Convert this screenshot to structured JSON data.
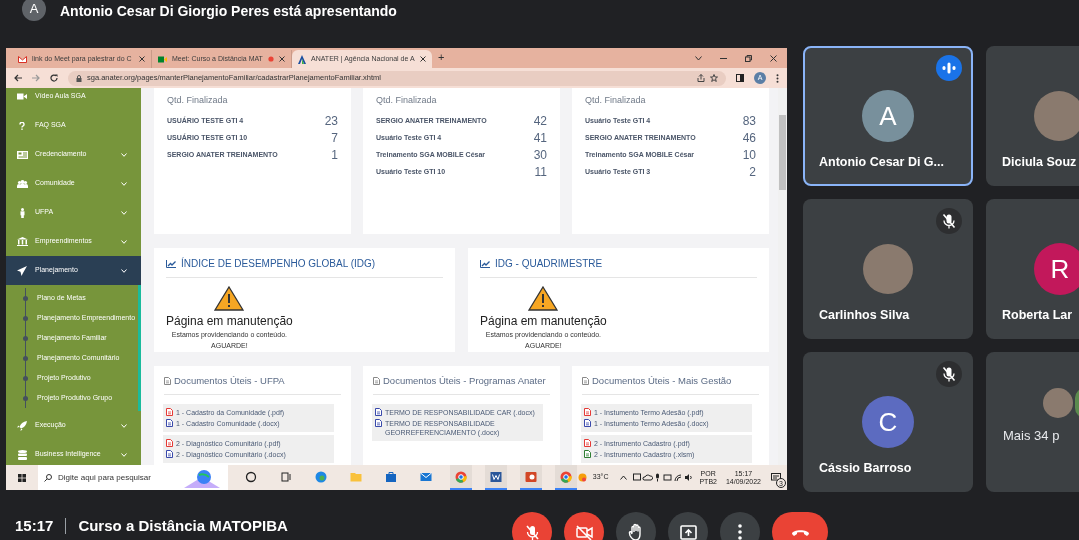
{
  "presenter_banner": {
    "avatar": "A",
    "text": "Antonio Cesar Di Giorgio Peres está apresentando"
  },
  "shared_screen": {
    "browser_tabs": [
      {
        "kind": "gmail",
        "title": "link do Meet para palestrar do C",
        "selected": false,
        "recording": false
      },
      {
        "kind": "meet",
        "title": "Meet: Curso a Distância MAT",
        "selected": false,
        "recording": true
      },
      {
        "kind": "anater",
        "title": "ANATER | Agência Nacional de A",
        "selected": true,
        "recording": false
      }
    ],
    "new_tab": "+",
    "address": "sga.anater.org/pages/manterPlanejamentoFamiliar/cadastrarPlanejamentoFamiliar.xhtml",
    "profile_avatar": "A",
    "sidebar": [
      {
        "kind": "video",
        "label": "Vídeo Aula SGA",
        "expandable": false,
        "selected": false
      },
      {
        "kind": "help",
        "label": "FAQ SGA",
        "expandable": false,
        "selected": false
      },
      {
        "kind": "card",
        "label": "Credenciamento",
        "expandable": true,
        "selected": false
      },
      {
        "kind": "people",
        "label": "Comunidade",
        "expandable": true,
        "selected": false
      },
      {
        "kind": "person",
        "label": "UFPA",
        "expandable": true,
        "selected": false
      },
      {
        "kind": "building",
        "label": "Empreendimentos",
        "expandable": true,
        "selected": false
      },
      {
        "kind": "plane",
        "label": "Planejamento",
        "expandable": true,
        "selected": true,
        "children": [
          {
            "label": "Plano de Metas",
            "selected": false
          },
          {
            "label": "Planejamento Empreendimento",
            "selected": false
          },
          {
            "label": "Planejamento Familiar",
            "selected": false
          },
          {
            "label": "Planejamento Comunitário",
            "selected": false
          },
          {
            "label": "Projeto Produtivo",
            "selected": false
          },
          {
            "label": "Projeto Produtivo Grupo",
            "selected": false
          }
        ]
      },
      {
        "kind": "rocket",
        "label": "Execução",
        "expandable": true,
        "selected": false
      },
      {
        "kind": "database",
        "label": "Business Intelligence",
        "expandable": true,
        "selected": false
      }
    ],
    "count_cards": [
      {
        "title": "Qtd. Finalizada",
        "rows": [
          {
            "name": "USUÁRIO TESTE GTI 4",
            "value": "23"
          },
          {
            "name": "USUÁRIO TESTE GTI 10",
            "value": "7"
          },
          {
            "name": "SERGIO ANATER TREINAMENTO",
            "value": "1"
          }
        ]
      },
      {
        "title": "Qtd. Finalizada",
        "rows": [
          {
            "name": "SERGIO ANATER TREINAMENTO",
            "value": "42"
          },
          {
            "name": "Usuário Teste GTI 4",
            "value": "41"
          },
          {
            "name": "Treinamento SGA MOBILE César",
            "value": "30"
          },
          {
            "name": "Usuário Teste GTI 10",
            "value": "11"
          }
        ]
      },
      {
        "title": "Qtd. Finalizada",
        "rows": [
          {
            "name": "Usuário Teste GTI 4",
            "value": "83"
          },
          {
            "name": "SERGIO ANATER TREINAMENTO",
            "value": "46"
          },
          {
            "name": "Treinamento SGA MOBILE César",
            "value": "10"
          },
          {
            "name": "Usuário Teste GTI 3",
            "value": "2"
          }
        ]
      }
    ],
    "idg_cards": [
      {
        "title": "ÍNDICE DE DESEMPENHO GLOBAL (IDG)",
        "message": "Página em manutenção",
        "detail": "Estamos providenciando o conteúdo.",
        "wait": "AGUARDE!"
      },
      {
        "title": "IDG - QUADRIMESTRE",
        "message": "Página em manutenção",
        "detail": "Estamos providenciando o conteúdo.",
        "wait": "AGUARDE!"
      }
    ],
    "document_cards": [
      {
        "title": "Documentos Úteis - UFPA",
        "groups": [
          [
            {
              "kind": "pdf",
              "label": "1 - Cadastro da Comunidade (.pdf)"
            },
            {
              "kind": "docx",
              "label": "1 - Cadastro Comunidade (.docx)"
            }
          ],
          [
            {
              "kind": "pdf",
              "label": "2 - Diagnóstico Comunitário (.pdf)"
            },
            {
              "kind": "docx",
              "label": "2 - Diagnóstico Comunitário (.docx)"
            }
          ]
        ]
      },
      {
        "title": "Documentos Úteis - Programas Anater",
        "groups": [
          [
            {
              "kind": "docx",
              "label": "TERMO DE RESPONSABILIDADE CAR (.docx)"
            },
            {
              "kind": "docx",
              "label": "TERMO DE RESPONSABILIDADE GEORREFERENCIAMENTO (.docx)"
            }
          ]
        ]
      },
      {
        "title": "Documentos Úteis - Mais Gestão",
        "groups": [
          [
            {
              "kind": "pdf",
              "label": "1 - Instumento Termo Adesão (.pdf)"
            },
            {
              "kind": "docx",
              "label": "1 - Instumento Termo Adesão (.docx)"
            }
          ],
          [
            {
              "kind": "pdf",
              "label": "2 - Instrumento Cadastro (.pdf)"
            },
            {
              "kind": "xlsm",
              "label": "2 - Instrumento Cadastro (.xlsm)"
            }
          ]
        ]
      }
    ],
    "taskbar": {
      "search_placeholder": "Digite aqui para pesquisar",
      "apps": [
        {
          "kind": "cortana",
          "active": false
        },
        {
          "kind": "taskview",
          "active": false
        },
        {
          "kind": "edge",
          "active": false
        },
        {
          "kind": "folder",
          "active": false
        },
        {
          "kind": "store",
          "active": false
        },
        {
          "kind": "mail",
          "active": false
        },
        {
          "kind": "chrome",
          "active": true
        },
        {
          "kind": "word",
          "active": true
        },
        {
          "kind": "powerpoint",
          "active": true
        },
        {
          "kind": "chrome",
          "active": true
        }
      ],
      "temperature": "33°C",
      "language": "POR",
      "layout": "PTB2",
      "time": "15:17",
      "date": "14/09/2022",
      "notifications": "3"
    }
  },
  "participants": [
    {
      "kind": "letter",
      "name": "Antonio Cesar Di G...",
      "initial": "A",
      "color": "#78909c",
      "speaking": true,
      "muted": false
    },
    {
      "kind": "photo",
      "name": "Diciula Souz",
      "speaking": false,
      "muted": false
    },
    {
      "kind": "photo",
      "name": "Carlinhos Silva",
      "speaking": false,
      "muted": true
    },
    {
      "kind": "letter",
      "name": "Roberta Lar",
      "initial": "R",
      "color": "#c2185b",
      "speaking": false,
      "muted": false
    },
    {
      "kind": "letter",
      "name": "Cássio Barroso",
      "initial": "C",
      "color": "#5c6bc0",
      "speaking": false,
      "muted": true
    },
    {
      "kind": "more",
      "name": "Mais 34 p",
      "speaking": false,
      "muted": false
    }
  ],
  "bottom_bar": {
    "time": "15:17",
    "meeting": "Curso a Distância MATOPIBA",
    "controls": [
      {
        "kind": "mic",
        "on": false
      },
      {
        "kind": "camera",
        "on": false
      },
      {
        "kind": "hand",
        "on": false
      },
      {
        "kind": "present",
        "on": false
      },
      {
        "kind": "more",
        "on": false
      },
      {
        "kind": "leave"
      }
    ]
  }
}
